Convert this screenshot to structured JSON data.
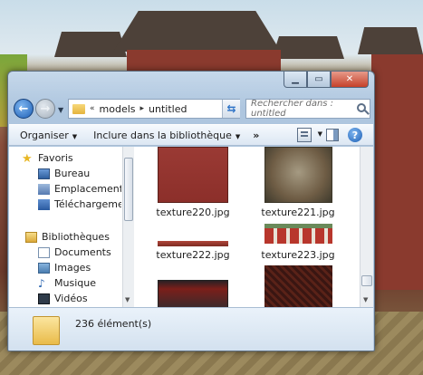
{
  "navigation": {
    "breadcrumb": [
      "models",
      "untitled"
    ],
    "search_placeholder": "Rechercher dans : untitled"
  },
  "toolbar": {
    "organize": "Organiser",
    "include_library": "Inclure dans la bibliothèque",
    "more": "»"
  },
  "sidebar": {
    "favorites": "Favoris",
    "favorites_items": [
      "Bureau",
      "Emplacements ré",
      "Téléchargements"
    ],
    "libraries": "Bibliothèques",
    "libraries_items": [
      "Documents",
      "Images",
      "Musique",
      "Vidéos"
    ]
  },
  "files": [
    {
      "name": "texture220.jpg"
    },
    {
      "name": "texture221.jpg"
    },
    {
      "name": "texture222.jpg"
    },
    {
      "name": "texture223.jpg"
    },
    {
      "name": ""
    },
    {
      "name": ""
    }
  ],
  "status": {
    "item_count": "236 élément(s)"
  }
}
